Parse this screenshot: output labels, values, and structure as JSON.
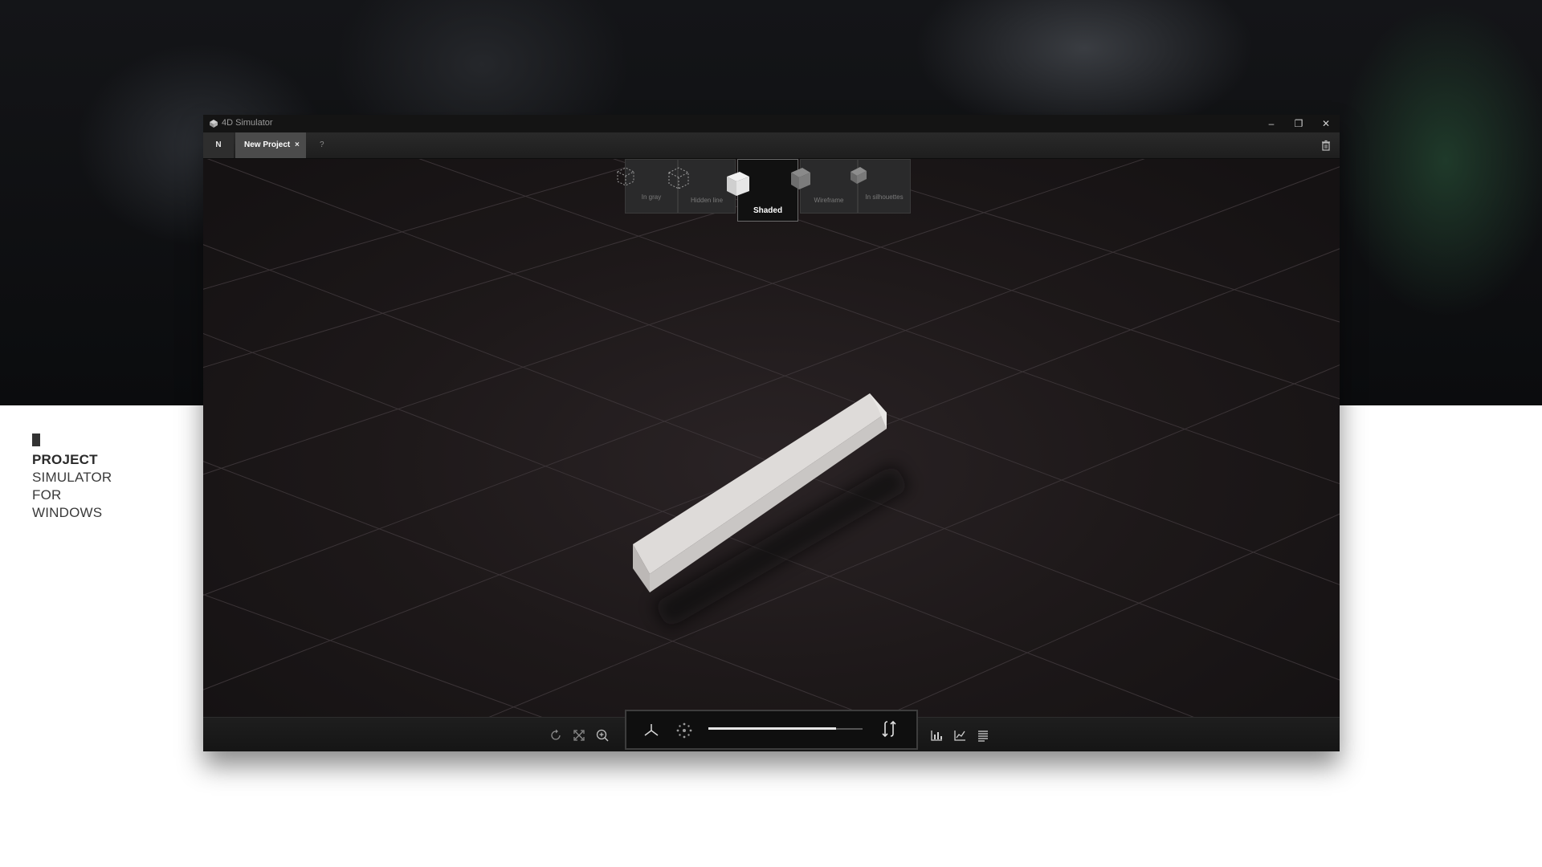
{
  "window": {
    "title": "4D Simulator",
    "controls": [
      "–",
      "❐",
      "✕"
    ]
  },
  "tabs": {
    "n_label": "N",
    "project_label": "New Project",
    "project_close": "×",
    "help_label": "?"
  },
  "view_modes": [
    {
      "label": "In gray",
      "icon": "gray-cube-icon"
    },
    {
      "label": "Hidden line",
      "icon": "hidden-line-cube-icon"
    },
    {
      "label": "Shaded",
      "icon": "shaded-cube-icon",
      "active": true
    },
    {
      "label": "Wireframe",
      "icon": "wireframe-cube-icon"
    },
    {
      "label": "In silhouettes",
      "icon": "silhouette-cube-icon"
    }
  ],
  "toolbar": {
    "left_icons": [
      "rotate-icon",
      "fit-view-icon",
      "zoom-icon"
    ],
    "play_icons": [
      "axes-icon",
      "explode-icon",
      "swap-icon"
    ],
    "timeline_progress": 0.83,
    "right_icons": [
      "bar-chart-icon",
      "line-chart-icon",
      "list-icon"
    ]
  },
  "brand": {
    "line1": "PROJECT",
    "line2": "SIMULATOR",
    "line3": "FOR",
    "line4": "WINDOWS"
  },
  "colors": {
    "viewport_bg": "#1d1819",
    "active_mode_bg": "#111111",
    "grid_line": "#3a3436",
    "object": "#d9d6d4"
  }
}
